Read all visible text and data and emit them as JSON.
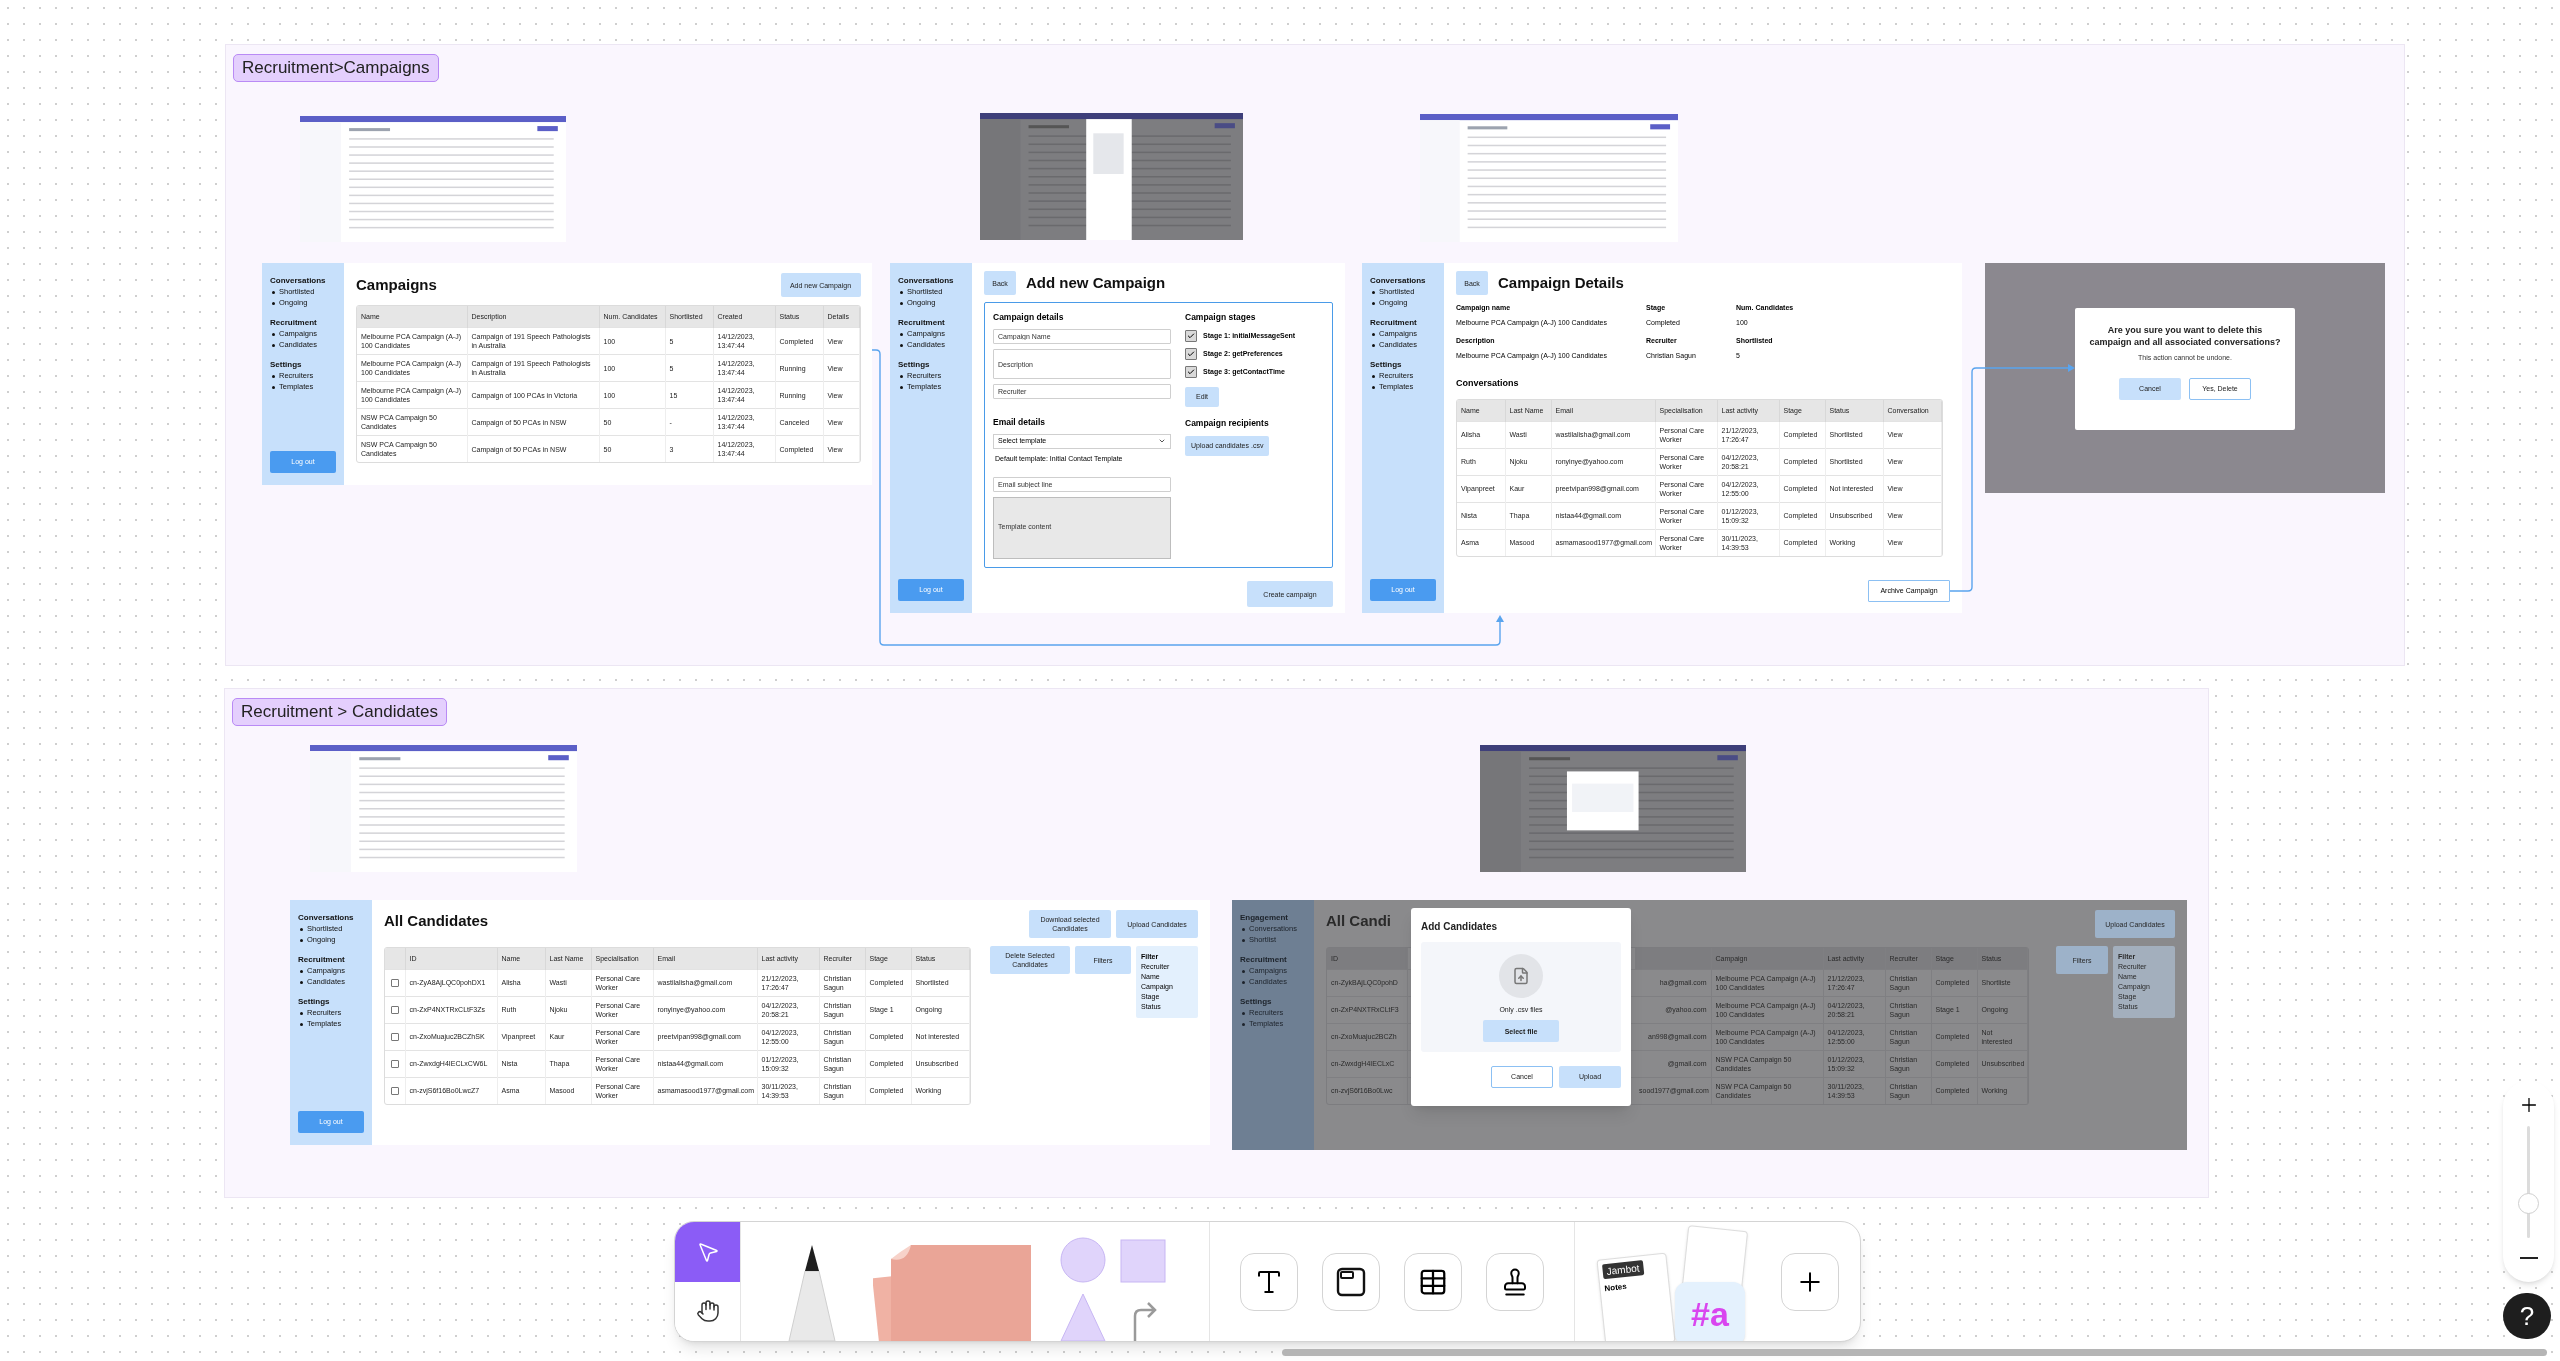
{
  "sections": [
    {
      "title": "Recruitment>Campaigns"
    },
    {
      "title": "Recruitment > Candidates"
    }
  ],
  "campaigns_page": {
    "sidebar": {
      "groups": [
        {
          "heading": "Conversations",
          "items": [
            "Shortlisted",
            "Ongoing"
          ]
        },
        {
          "heading": "Recruitment",
          "items": [
            "Campaigns",
            "Candidates"
          ]
        },
        {
          "heading": "Settings",
          "items": [
            "Recruiters",
            "Templates"
          ]
        }
      ],
      "logout": "Log out"
    },
    "title": "Campaigns",
    "add_button": "Add new Campaign",
    "table": {
      "columns": [
        "Name",
        "Description",
        "Num. Candidates",
        "Shortlisted",
        "Created",
        "Status",
        "Details"
      ],
      "rows": [
        [
          "Melbourne PCA Campaign (A-J) 100 Candidates",
          "Campaign of 191 Speech Pathologists in Australia",
          "100",
          "5",
          "14/12/2023, 13:47:44",
          "Completed",
          "View"
        ],
        [
          "Melbourne PCA Campaign (A-J) 100 Candidates",
          "Campaign of 191 Speech Pathologists in Australia",
          "100",
          "5",
          "14/12/2023, 13:47:44",
          "Running",
          "View"
        ],
        [
          "Melbourne PCA Campaign (A-J) 100 Candidates",
          "Campaign of 100 PCAs in Victoria",
          "100",
          "15",
          "14/12/2023, 13:47:44",
          "Running",
          "View"
        ],
        [
          "NSW PCA Campaign 50 Candidates",
          "Campaign of 50 PCAs in NSW",
          "50",
          "-",
          "14/12/2023, 13:47:44",
          "Canceled",
          "View"
        ],
        [
          "NSW PCA Campaign 50 Candidates",
          "Campaign of 50 PCAs in NSW",
          "50",
          "3",
          "14/12/2023, 13:47:44",
          "Completed",
          "View"
        ]
      ]
    }
  },
  "add_campaign_page": {
    "sidebar": {
      "groups": [
        {
          "heading": "Conversations",
          "items": [
            "Shortlisted",
            "Ongoing"
          ]
        },
        {
          "heading": "Recruitment",
          "items": [
            "Campaigns",
            "Candidates"
          ]
        },
        {
          "heading": "Settings",
          "items": [
            "Recruiters",
            "Templates"
          ]
        }
      ],
      "logout": "Log out"
    },
    "back": "Back",
    "title": "Add new Campaign",
    "details_heading": "Campaign details",
    "fields": [
      {
        "kind": "input",
        "placeholder": "Campaign Name"
      },
      {
        "kind": "textarea",
        "placeholder": "Description"
      },
      {
        "kind": "input",
        "placeholder": "Recruiter"
      }
    ],
    "email_heading": "Email details",
    "template_select": "Select template",
    "template_hint": "Default template: Initial Contact Template",
    "subject": {
      "placeholder": "Email subject line"
    },
    "content": {
      "placeholder": "Template content"
    },
    "stages_heading": "Campaign stages",
    "stages": [
      {
        "label": "Stage 1: initialMessageSent",
        "checked": true
      },
      {
        "label": "Stage 2: getPreferences",
        "checked": true
      },
      {
        "label": "Stage 3: getContactTime",
        "checked": true
      }
    ],
    "edit_button": "Edit",
    "recipients_heading": "Campaign recipients",
    "upload_button": "Upload candidates .csv",
    "create_button": "Create campaign"
  },
  "campaign_details_page": {
    "sidebar": {
      "groups": [
        {
          "heading": "Conversations",
          "items": [
            "Shortlisted",
            "Ongoing"
          ]
        },
        {
          "heading": "Recruitment",
          "items": [
            "Campaigns",
            "Candidates"
          ]
        },
        {
          "heading": "Settings",
          "items": [
            "Recruiters",
            "Templates"
          ]
        }
      ],
      "logout": "Log out"
    },
    "back": "Back",
    "title": "Campaign Details",
    "info": [
      {
        "label": "Campaign name",
        "value": "Melbourne PCA Campaign (A-J) 100 Candidates"
      },
      {
        "label": "Stage",
        "value": "Completed"
      },
      {
        "label": "Num. Candidates",
        "value": "100"
      },
      {
        "label": "Description",
        "value": "Melbourne PCA Campaign (A-J) 100 Candidates"
      },
      {
        "label": "Recruiter",
        "value": "Christian Sagun"
      },
      {
        "label": "Shortlisted",
        "value": "5"
      }
    ],
    "conversations_heading": "Conversations",
    "table": {
      "columns": [
        "Name",
        "Last Name",
        "Email",
        "Specialisation",
        "Last activity",
        "Stage",
        "Status",
        "Conversation"
      ],
      "rows": [
        [
          "Alisha",
          "Wasti",
          "wastilalisha@gmail.com",
          "Personal Care Worker",
          "21/12/2023, 17:26:47",
          "Completed",
          "Shortlisted",
          "View"
        ],
        [
          "Ruth",
          "Njoku",
          "ronyinye@yahoo.com",
          "Personal Care Worker",
          "04/12/2023, 20:58:21",
          "Completed",
          "Shortlisted",
          "View"
        ],
        [
          "Vipanpreet",
          "Kaur",
          "preetvipan998@gmail.com",
          "Personal Care Worker",
          "04/12/2023, 12:55:00",
          "Completed",
          "Not interested",
          "View"
        ],
        [
          "Nista",
          "Thapa",
          "nistaa44@gmail.com",
          "Personal Care Worker",
          "01/12/2023, 15:09:32",
          "Completed",
          "Unsubscribed",
          "View"
        ],
        [
          "Asma",
          "Masood",
          "asmamasood1977@gmail.com",
          "Personal Care Worker",
          "30/11/2023, 14:39:53",
          "Completed",
          "Working",
          "View"
        ]
      ]
    }
  },
  "archive_button": "Archive Campaign",
  "delete_dialog": {
    "question": "Are you sure you want to delete this campaign and all associated conversations?",
    "note": "This action cannot be undone.",
    "cancel": "Cancel",
    "confirm": "Yes, Delete"
  },
  "candidates_page": {
    "sidebar": {
      "groups": [
        {
          "heading": "Conversations",
          "items": [
            "Shortlisted",
            "Ongoing"
          ]
        },
        {
          "heading": "Recruitment",
          "items": [
            "Campaigns",
            "Candidates"
          ]
        },
        {
          "heading": "Settings",
          "items": [
            "Recruiters",
            "Templates"
          ]
        }
      ],
      "logout": "Log out"
    },
    "title": "All Candidates",
    "download_button": "Download selected Candidates",
    "upload_button": "Upload Candidates",
    "delete_button": "Delete  Selected Candidates",
    "filters_button": "Filters",
    "filter_panel": {
      "heading": "Filter",
      "options": [
        "Recruiter",
        "Name",
        "Campaign",
        "Stage",
        "Status"
      ]
    },
    "table": {
      "columns": [
        "ID",
        "Name",
        "Last Name",
        "Specialisation",
        "Email",
        "Last activity",
        "Recruiter",
        "Stage",
        "Status"
      ],
      "rows": [
        {
          "checked": false,
          "cells": [
            "cn-ZyA8AjLQC0pohDX1",
            "Alisha",
            "Wasti",
            "Personal Care Worker",
            "wastilalisha@gmail.com",
            "21/12/2023, 17:26:47",
            "Christian Sagun",
            "Completed",
            "Shortlisted"
          ]
        },
        {
          "checked": false,
          "cells": [
            "cn-ZxP4NXTRxCLtF3Zs",
            "Ruth",
            "Njoku",
            "Personal Care Worker",
            "ronyinye@yahoo.com",
            "04/12/2023, 20:58:21",
            "Christian Sagun",
            "Stage 1",
            "Ongoing"
          ]
        },
        {
          "checked": false,
          "cells": [
            "cn-ZxoMuajuc2BCZhSK",
            "Vipanpreet",
            "Kaur",
            "Personal Care Worker",
            "preetvipan998@gmail.com",
            "04/12/2023, 12:55:00",
            "Christian Sagun",
            "Completed",
            "Not interested"
          ]
        },
        {
          "checked": false,
          "cells": [
            "cn-ZwxdgH4IECLxCW6L",
            "Nista",
            "Thapa",
            "Personal Care Worker",
            "nistaa44@gmail.com",
            "01/12/2023, 15:09:32",
            "Christian Sagun",
            "Completed",
            "Unsubscribed"
          ]
        },
        {
          "checked": false,
          "cells": [
            "cn-zvjS6f16Bo0LwcZ7",
            "Asma",
            "Masood",
            "Personal Care Worker",
            "asmamasood1977@gmail.com",
            "30/11/2023, 14:39:53",
            "Christian Sagun",
            "Completed",
            "Working"
          ]
        }
      ]
    }
  },
  "add_candidates_page": {
    "sidebar": {
      "groups": [
        {
          "heading": "Engagement",
          "items": [
            "Conversations",
            "Shortlist"
          ]
        },
        {
          "heading": "Recruitment",
          "items": [
            "Campaigns",
            "Candidates"
          ]
        },
        {
          "heading": "Settings",
          "items": [
            "Recruiters",
            "Templates"
          ]
        }
      ]
    },
    "title": "All Candi",
    "upload_button": "Upload Candidates",
    "filters_button": "Filters",
    "filter_panel": {
      "heading": "Filter",
      "options": [
        "Recruiter",
        "Name",
        "Campaign",
        "Stage",
        "Status"
      ]
    },
    "table": {
      "columns": [
        "ID",
        "Campaign",
        "Last activity",
        "Recruiter",
        "Stage",
        "Status"
      ],
      "rows": [
        {
          "id": "cn-ZykBAjLQC0pohD",
          "email": "ha@gmail.com",
          "campaign": "Melbourne PCA Campaign (A-J) 100 Candidates",
          "activity": "21/12/2023, 17:26:47",
          "recruiter": "Christian Sagun",
          "stage": "Completed",
          "status": "Shortliste"
        },
        {
          "id": "cn-ZxP4NXTRxCLtF3",
          "email": "@yahoo.com",
          "campaign": "Melbourne PCA Campaign (A-J) 100 Candidates",
          "activity": "04/12/2023, 20:58:21",
          "recruiter": "Christian Sagun",
          "stage": "Stage 1",
          "status": "Ongoing"
        },
        {
          "id": "cn-ZxoMuajuc2BCZh",
          "email": "an998@gmail.com",
          "campaign": "Melbourne PCA Campaign (A-J) 100 Candidates",
          "activity": "04/12/2023, 12:55:00",
          "recruiter": "Christian Sagun",
          "stage": "Completed",
          "status": "Not interested"
        },
        {
          "id": "cn-ZwxdgH4IECLxC",
          "email": "@gmail.com",
          "campaign": "NSW PCA Campaign 50 Candidates",
          "activity": "01/12/2023, 15:09:32",
          "recruiter": "Christian Sagun",
          "stage": "Completed",
          "status": "Unsubscribed"
        },
        {
          "id": "cn-zvjS6f16Bo0Lwc",
          "email": "sood1977@gmail.com",
          "campaign": "NSW PCA Campaign 50 Candidates",
          "activity": "30/11/2023, 14:39:53",
          "recruiter": "Christian Sagun",
          "stage": "Completed",
          "status": "Working"
        }
      ]
    },
    "modal": {
      "title": "Add Candidates",
      "hint": "Only .csv files",
      "select_button": "Select file",
      "cancel": "Cancel",
      "upload": "Upload"
    }
  },
  "toolbar": {
    "tools": [
      {
        "kind": "select",
        "selected": true
      },
      {
        "kind": "hand",
        "selected": false
      }
    ],
    "widgets": {
      "jambot": "Jambot",
      "notes": "Notes",
      "tag": "#a"
    }
  },
  "zoom": {
    "level": 0.26
  },
  "help": {
    "label": "?"
  }
}
